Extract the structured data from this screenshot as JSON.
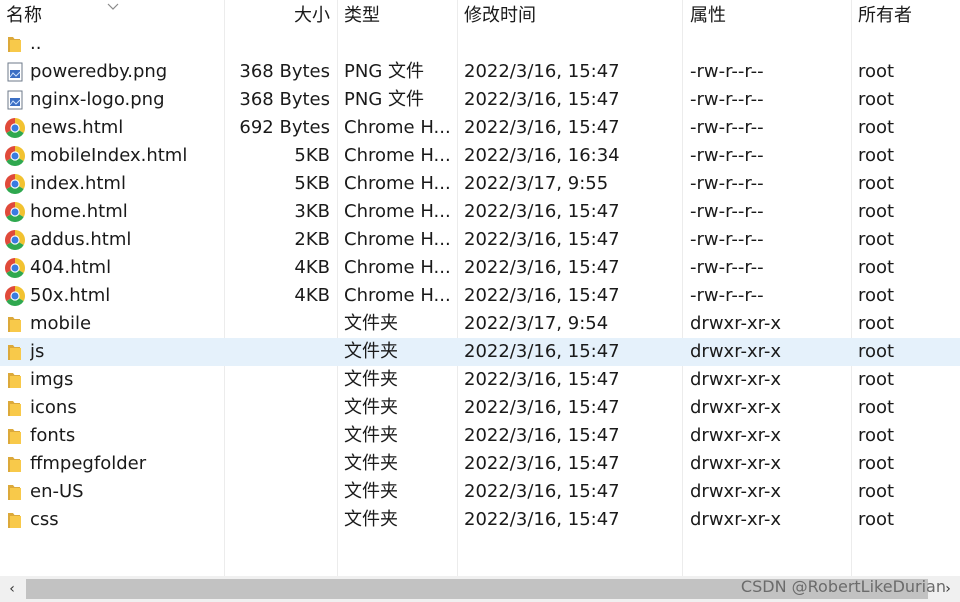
{
  "columns": {
    "name": "名称",
    "size": "大小",
    "type": "类型",
    "modified": "修改时间",
    "permissions": "属性",
    "owner": "所有者"
  },
  "files": [
    {
      "icon": "folder-icon",
      "name": "..",
      "size": "",
      "type": "",
      "modified": "",
      "permissions": "",
      "owner": ""
    },
    {
      "icon": "image-file-icon",
      "name": "poweredby.png",
      "size": "368 Bytes",
      "type": "PNG 文件",
      "modified": "2022/3/16, 15:47",
      "permissions": "-rw-r--r--",
      "owner": "root"
    },
    {
      "icon": "image-file-icon",
      "name": "nginx-logo.png",
      "size": "368 Bytes",
      "type": "PNG 文件",
      "modified": "2022/3/16, 15:47",
      "permissions": "-rw-r--r--",
      "owner": "root"
    },
    {
      "icon": "chrome-icon",
      "name": "news.html",
      "size": "692 Bytes",
      "type": "Chrome H...",
      "modified": "2022/3/16, 15:47",
      "permissions": "-rw-r--r--",
      "owner": "root"
    },
    {
      "icon": "chrome-icon",
      "name": "mobileIndex.html",
      "size": "5KB",
      "type": "Chrome H...",
      "modified": "2022/3/16, 16:34",
      "permissions": "-rw-r--r--",
      "owner": "root"
    },
    {
      "icon": "chrome-icon",
      "name": "index.html",
      "size": "5KB",
      "type": "Chrome H...",
      "modified": "2022/3/17, 9:55",
      "permissions": "-rw-r--r--",
      "owner": "root"
    },
    {
      "icon": "chrome-icon",
      "name": "home.html",
      "size": "3KB",
      "type": "Chrome H...",
      "modified": "2022/3/16, 15:47",
      "permissions": "-rw-r--r--",
      "owner": "root"
    },
    {
      "icon": "chrome-icon",
      "name": "addus.html",
      "size": "2KB",
      "type": "Chrome H...",
      "modified": "2022/3/16, 15:47",
      "permissions": "-rw-r--r--",
      "owner": "root"
    },
    {
      "icon": "chrome-icon",
      "name": "404.html",
      "size": "4KB",
      "type": "Chrome H...",
      "modified": "2022/3/16, 15:47",
      "permissions": "-rw-r--r--",
      "owner": "root"
    },
    {
      "icon": "chrome-icon",
      "name": "50x.html",
      "size": "4KB",
      "type": "Chrome H...",
      "modified": "2022/3/16, 15:47",
      "permissions": "-rw-r--r--",
      "owner": "root"
    },
    {
      "icon": "folder-icon",
      "name": "mobile",
      "size": "",
      "type": "文件夹",
      "modified": "2022/3/17, 9:54",
      "permissions": "drwxr-xr-x",
      "owner": "root"
    },
    {
      "icon": "folder-icon",
      "name": "js",
      "size": "",
      "type": "文件夹",
      "modified": "2022/3/16, 15:47",
      "permissions": "drwxr-xr-x",
      "owner": "root",
      "selected": true
    },
    {
      "icon": "folder-icon",
      "name": "imgs",
      "size": "",
      "type": "文件夹",
      "modified": "2022/3/16, 15:47",
      "permissions": "drwxr-xr-x",
      "owner": "root"
    },
    {
      "icon": "folder-icon",
      "name": "icons",
      "size": "",
      "type": "文件夹",
      "modified": "2022/3/16, 15:47",
      "permissions": "drwxr-xr-x",
      "owner": "root"
    },
    {
      "icon": "folder-icon",
      "name": "fonts",
      "size": "",
      "type": "文件夹",
      "modified": "2022/3/16, 15:47",
      "permissions": "drwxr-xr-x",
      "owner": "root"
    },
    {
      "icon": "folder-icon",
      "name": "ffmpegfolder",
      "size": "",
      "type": "文件夹",
      "modified": "2022/3/16, 15:47",
      "permissions": "drwxr-xr-x",
      "owner": "root"
    },
    {
      "icon": "folder-icon",
      "name": "en-US",
      "size": "",
      "type": "文件夹",
      "modified": "2022/3/16, 15:47",
      "permissions": "drwxr-xr-x",
      "owner": "root"
    },
    {
      "icon": "folder-icon",
      "name": "css",
      "size": "",
      "type": "文件夹",
      "modified": "2022/3/16, 15:47",
      "permissions": "drwxr-xr-x",
      "owner": "root"
    }
  ],
  "scrollbar": {
    "left_arrow": "‹",
    "right_arrow": "›"
  },
  "watermark": "CSDN @RobertLikeDurian",
  "colors": {
    "selected_row": "#e5f1fb",
    "folder": "#f8c94a",
    "scrollbar_thumb": "#c2c2c2"
  }
}
